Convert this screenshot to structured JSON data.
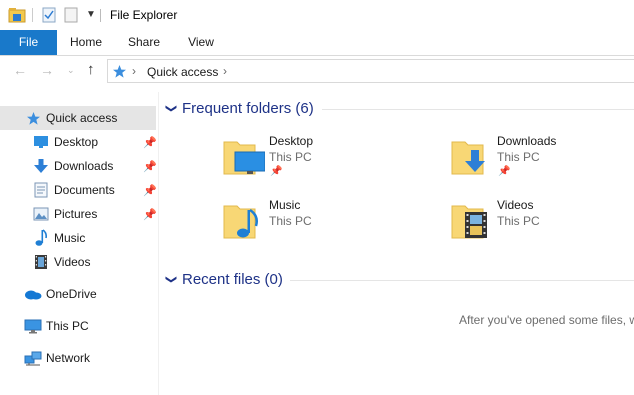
{
  "window": {
    "title": "File Explorer"
  },
  "ribbon": {
    "tabs": [
      "File",
      "Home",
      "Share",
      "View"
    ]
  },
  "address": {
    "path_root_icon": "star-quick-access-icon",
    "path": "Quick access"
  },
  "sidebar": {
    "items": [
      {
        "label": "Quick access",
        "icon": "star-icon",
        "pinned": false
      },
      {
        "label": "Desktop",
        "icon": "desktop-icon",
        "pinned": true
      },
      {
        "label": "Downloads",
        "icon": "download-arrow-icon",
        "pinned": true
      },
      {
        "label": "Documents",
        "icon": "documents-icon",
        "pinned": true
      },
      {
        "label": "Pictures",
        "icon": "pictures-icon",
        "pinned": true
      },
      {
        "label": "Music",
        "icon": "music-note-icon",
        "pinned": false
      },
      {
        "label": "Videos",
        "icon": "film-icon",
        "pinned": false
      },
      {
        "label": "OneDrive",
        "icon": "cloud-icon",
        "pinned": false
      },
      {
        "label": "This PC",
        "icon": "monitor-icon",
        "pinned": false
      },
      {
        "label": "Network",
        "icon": "network-icon",
        "pinned": false
      }
    ]
  },
  "frequent": {
    "header": "Frequent folders (6)",
    "folders": [
      {
        "name": "Desktop",
        "location": "This PC",
        "pinned": true
      },
      {
        "name": "Downloads",
        "location": "This PC",
        "pinned": true
      },
      {
        "name": "Music",
        "location": "This PC",
        "pinned": false
      },
      {
        "name": "Videos",
        "location": "This PC",
        "pinned": false
      }
    ]
  },
  "recent": {
    "header": "Recent files (0)",
    "empty_message": "After you've opened some files, w"
  },
  "colors": {
    "accent": "#1979ca",
    "header_text": "#1e3287",
    "selection": "#cce8ff",
    "folder": "#f8d775"
  }
}
